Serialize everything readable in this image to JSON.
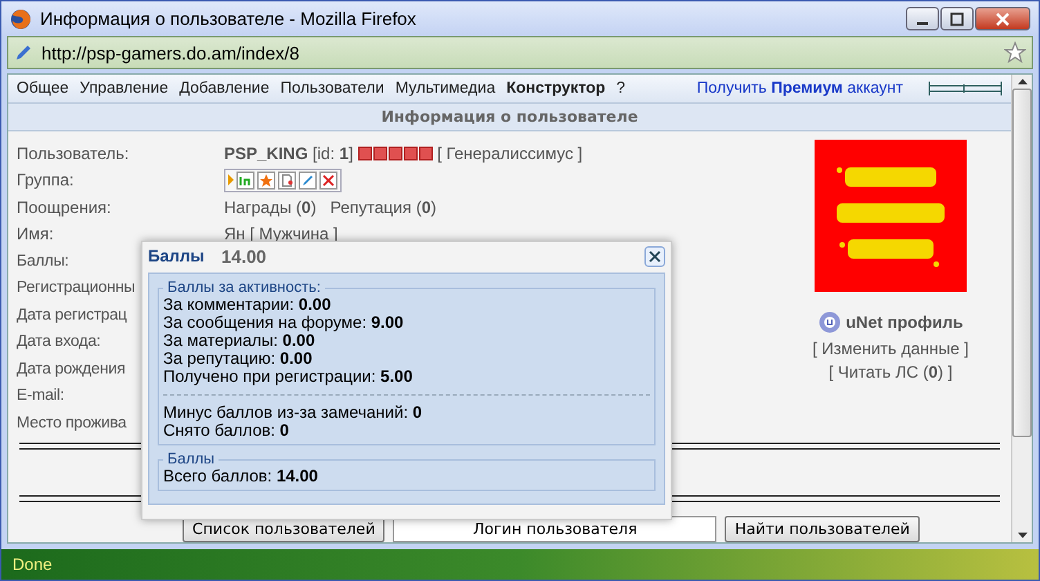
{
  "window": {
    "title": "Информация о пользователе - Mozilla Firefox"
  },
  "address_bar": {
    "url": "http://psp-gamers.do.am/index/8"
  },
  "menu": [
    {
      "label": "Общее",
      "bold": false
    },
    {
      "label": "Управление",
      "bold": false
    },
    {
      "label": "Добавление",
      "bold": false
    },
    {
      "label": "Пользователи",
      "bold": false
    },
    {
      "label": "Мультимедиа",
      "bold": false
    },
    {
      "label": "Конструктор",
      "bold": true
    },
    {
      "label": "?",
      "bold": false
    }
  ],
  "premium_link": "Получить **Премиум** аккаунт",
  "section_title": "Информация о пользователе",
  "profile": {
    "user": {
      "label": "Пользователь:",
      "name": "PSP_KING",
      "id_text": "[id: **1**]",
      "stars": 5,
      "rank": "[ Генералиссимус ]"
    },
    "group": {
      "label": "Группа:"
    },
    "rewards": {
      "label": "Поощрения:",
      "awards": "Награды (**0**)",
      "reputation": "Репутация (**0**)"
    },
    "name": {
      "label": "Имя:",
      "value": "Ян [ Мужчина ]"
    },
    "hidden_labels": [
      "Баллы:",
      "Регистрационны",
      "Дата регистрац",
      "Дата входа:",
      "Дата рождения",
      "E-mail:",
      "Место прожива"
    ],
    "unet_profile": "uNet профиль",
    "edit_link": "[ Изменить данные ]",
    "messages_link": "[ Читать ЛС (**0**) ]"
  },
  "points_popup": {
    "title": "Баллы",
    "total": "14.00",
    "activity": {
      "legend": "Баллы за активность:",
      "lines": [
        {
          "label": "За комментарии:",
          "value": "0.00"
        },
        {
          "label": "За сообщения на форуме:",
          "value": "9.00"
        },
        {
          "label": "За материалы:",
          "value": "0.00"
        },
        {
          "label": "За репутацию:",
          "value": "0.00"
        },
        {
          "label": "Получено при регистрации:",
          "value": "5.00"
        }
      ],
      "penalties": [
        {
          "label": "Минус баллов из-за замечаний:",
          "value": "0"
        },
        {
          "label": "Снято баллов:",
          "value": "0"
        }
      ]
    },
    "summary": {
      "legend": "Баллы",
      "label": "Всего баллов:",
      "value": "14.00"
    }
  },
  "footer": {
    "list_button": "Список пользователей",
    "login_field": {
      "value": "Логин пользователя"
    },
    "find_button": "Найти пользователей"
  },
  "status_bar": "Done"
}
